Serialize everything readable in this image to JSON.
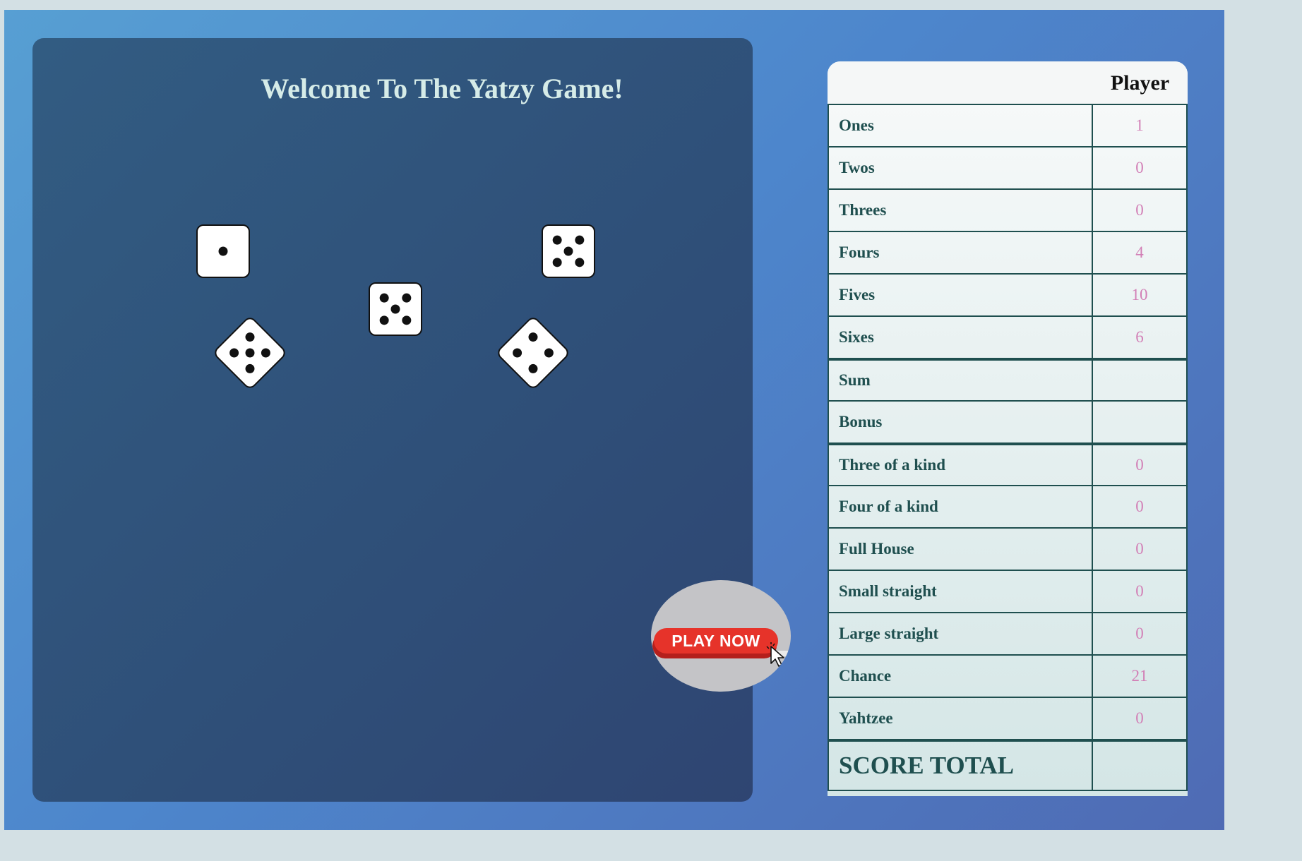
{
  "title": "Welcome To The Yatzy Game!",
  "dice": [
    {
      "id": "die-1",
      "value": 1,
      "rotated": false
    },
    {
      "id": "die-2",
      "value": 5,
      "rotated": false
    },
    {
      "id": "die-3",
      "value": 5,
      "rotated": false
    },
    {
      "id": "die-4",
      "value": 5,
      "rotated": true
    },
    {
      "id": "die-5",
      "value": 4,
      "rotated": true
    }
  ],
  "play_button": {
    "label": "PLAY NOW"
  },
  "scorecard": {
    "header": {
      "player": "Player"
    },
    "rows": [
      {
        "label": "Ones",
        "value": "1"
      },
      {
        "label": "Twos",
        "value": "0"
      },
      {
        "label": "Threes",
        "value": "0"
      },
      {
        "label": "Fours",
        "value": "4"
      },
      {
        "label": "Fives",
        "value": "10"
      },
      {
        "label": "Sixes",
        "value": "6"
      },
      {
        "label": "Sum",
        "value": ""
      },
      {
        "label": "Bonus",
        "value": ""
      },
      {
        "label": "Three of a kind",
        "value": "0"
      },
      {
        "label": "Four of a kind",
        "value": "0"
      },
      {
        "label": "Full House",
        "value": "0"
      },
      {
        "label": "Small straight",
        "value": "0"
      },
      {
        "label": "Large straight",
        "value": "0"
      },
      {
        "label": "Chance",
        "value": "21"
      },
      {
        "label": "Yahtzee",
        "value": "0"
      }
    ],
    "total": {
      "label": "SCORE TOTAL",
      "value": ""
    }
  },
  "colors": {
    "label_text": "#1f4f4f",
    "score_text": "#d27fb6",
    "play_button": "#e6332a"
  }
}
